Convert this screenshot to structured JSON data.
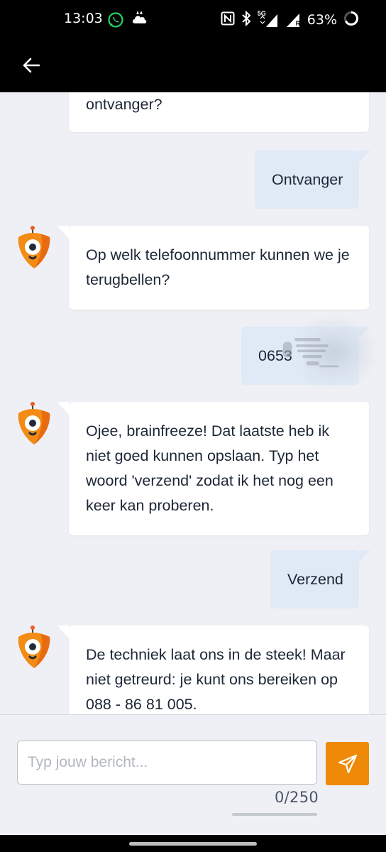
{
  "status_bar": {
    "time": "13:03",
    "network_label": "5G",
    "roaming_label": "R",
    "battery_percent": "63%"
  },
  "app_bar": {
    "back_icon": "arrow-left-icon"
  },
  "messages": [
    {
      "sender": "bot",
      "text": "ontvanger?"
    },
    {
      "sender": "user",
      "text": "Ontvanger"
    },
    {
      "sender": "bot",
      "text": "Op welk telefoonnummer kunnen we je terugbellen?"
    },
    {
      "sender": "user",
      "text": "0653"
    },
    {
      "sender": "bot",
      "text": "Ojee, brainfreeze! Dat laatste heb ik niet goed kunnen opslaan. Typ het woord 'verzend' zodat ik het nog een keer kan proberen."
    },
    {
      "sender": "user",
      "text": "Verzend"
    },
    {
      "sender": "bot",
      "text": "De techniek laat ons in de steek! Maar niet getreurd: je kunt ons bereiken op 088 - 86 81 005."
    }
  ],
  "composer": {
    "placeholder": "Typ jouw bericht...",
    "value": "",
    "counter": "0/250",
    "send_icon": "send-icon"
  },
  "colors": {
    "accent": "#ef8a09",
    "user_bubble": "#dfeaf6",
    "bot_bubble": "#ffffff",
    "chat_background": "#eff0f5"
  }
}
